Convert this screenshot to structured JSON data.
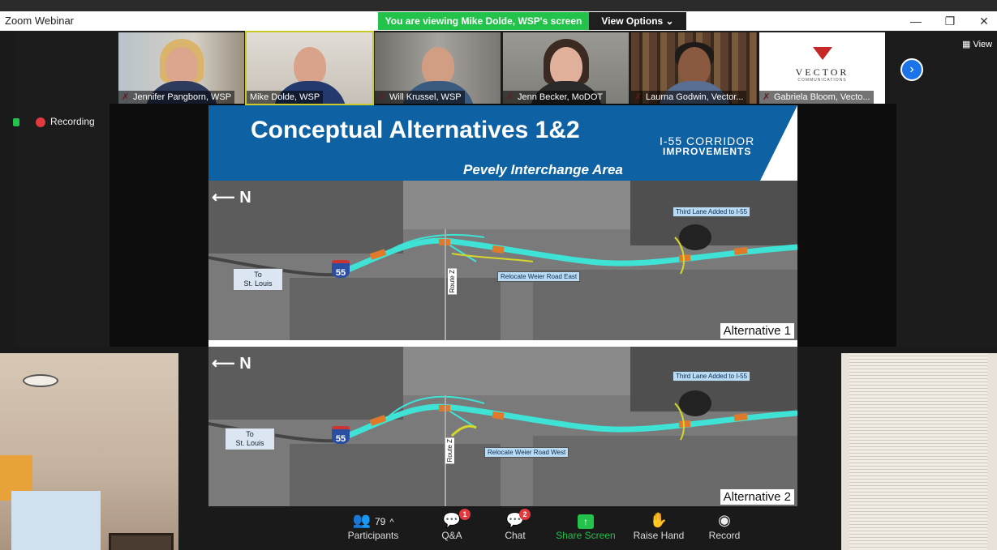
{
  "app": {
    "title": "Zoom Webinar",
    "viewing_banner": "You are viewing Mike Dolde, WSP's screen",
    "view_options": "View Options ⌄",
    "window_controls": {
      "minimize": "—",
      "restore": "❐",
      "close": "✕"
    }
  },
  "gallery": {
    "participants": [
      {
        "name": "Jennifer Pangborn, WSP",
        "muted": true
      },
      {
        "name": "Mike Dolde, WSP",
        "muted": false
      },
      {
        "name": "Will Krussel, WSP",
        "muted": true
      },
      {
        "name": "Jenn Becker, MoDOT",
        "muted": true
      },
      {
        "name": "Laurna Godwin, Vector...",
        "muted": true
      },
      {
        "name": "Gabriela Bloom, Vecto...",
        "muted": true
      }
    ],
    "logo_text": "VECTOR",
    "logo_subtext": "COMMUNICATIONS",
    "next_icon": "chevron-right-icon",
    "view_label": "View"
  },
  "status": {
    "recording": "Recording"
  },
  "slide": {
    "title": "Conceptual Alternatives 1&2",
    "corridor_line1": "I-55 CORRIDOR",
    "corridor_line2": "IMPROVEMENTS",
    "area": "Pevely Interchange Area",
    "north": "N",
    "interstate": "55",
    "to_label": "To\nSt. Louis",
    "route_label": "Route Z",
    "callout_third_lane": "Third Lane Added to I-55",
    "alt1": {
      "label": "Alternative 1",
      "relocate": "Relocate Weier Road East"
    },
    "alt2": {
      "label": "Alternative 2",
      "relocate": "Relocate Weier Road West"
    }
  },
  "toolbar": {
    "participants": {
      "label": "Participants",
      "count": "79"
    },
    "qa": {
      "label": "Q&A",
      "badge": "1"
    },
    "chat": {
      "label": "Chat",
      "badge": "2"
    },
    "share": {
      "label": "Share Screen"
    },
    "raise_hand": {
      "label": "Raise Hand"
    },
    "record": {
      "label": "Record"
    }
  },
  "colors": {
    "banner_green": "#23c24a",
    "slide_blue": "#0e62a3",
    "highway_cyan": "#3fe3d6",
    "segment_orange": "#e07a2a",
    "badge_red": "#e0393e"
  }
}
